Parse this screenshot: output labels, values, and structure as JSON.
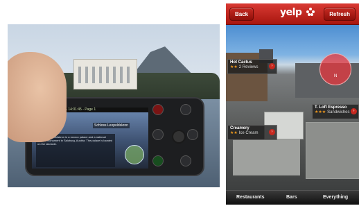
{
  "left_phone": {
    "statusbar_text": "Wikitude - Live View - 14:01:45 - Page 1",
    "poi_title": "Schloss Leopoldskron",
    "info_text": "Schloss Leopoldskron is a rococo palace and a national historic monument in Salzburg, Austria. The palace is located on the lakeside."
  },
  "yelp": {
    "nav": {
      "back_label": "Back",
      "logo": "yelp",
      "refresh_label": "Refresh"
    },
    "compass_label": "N",
    "pois": [
      {
        "name": "Hot Cactus",
        "review_text": "2 Reviews"
      },
      {
        "name": "T. Loft Espresso",
        "review_text": "Sandwiches"
      },
      {
        "name": "Creamery",
        "review_text": "Ice Cream"
      }
    ],
    "tabs": [
      "Restaurants",
      "Bars",
      "Everything"
    ],
    "colors": {
      "nav_red": "#c62a22",
      "star_orange": "#f29b1d"
    }
  }
}
